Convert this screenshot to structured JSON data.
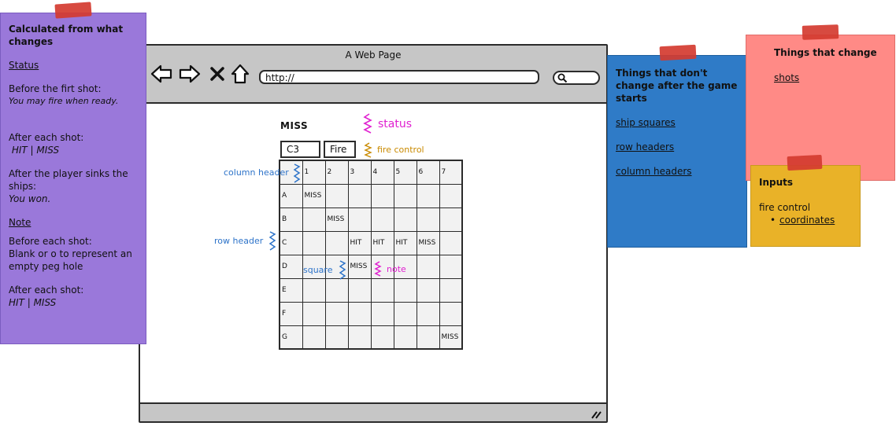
{
  "browser": {
    "title": "A Web Page",
    "address": "http://"
  },
  "content": {
    "status_text": "MISS",
    "annotations": {
      "status": "status",
      "fire_control": "fire control",
      "column_header": "column header",
      "row_header": "row header",
      "square": "square",
      "note": "note"
    },
    "coordinate_input": "C3",
    "fire_button": "Fire"
  },
  "board": {
    "column_headers": [
      "",
      "1",
      "2",
      "3",
      "4",
      "5",
      "6",
      "7"
    ],
    "rows": [
      {
        "header": "A",
        "cells": [
          "MISS",
          "",
          "",
          "",
          "",
          "",
          ""
        ]
      },
      {
        "header": "B",
        "cells": [
          "",
          "MISS",
          "",
          "",
          "",
          "",
          ""
        ]
      },
      {
        "header": "C",
        "cells": [
          "",
          "",
          "HIT",
          "HIT",
          "HIT",
          "MISS",
          ""
        ]
      },
      {
        "header": "D",
        "cells": [
          "",
          "",
          "MISS",
          "",
          "",
          "",
          ""
        ]
      },
      {
        "header": "E",
        "cells": [
          "",
          "",
          "",
          "",
          "",
          "",
          ""
        ]
      },
      {
        "header": "F",
        "cells": [
          "",
          "",
          "",
          "",
          "",
          "",
          ""
        ]
      },
      {
        "header": "G",
        "cells": [
          "",
          "",
          "",
          "",
          "",
          "",
          "MISS"
        ]
      }
    ]
  },
  "notes": {
    "purple": {
      "title": "Calculated from what changes",
      "status_link": "Status",
      "before_first": "Before the firt shot:",
      "before_first_value": "You may fire when ready.",
      "after_each": "After each shot:",
      "after_each_value": " HIT | MISS",
      "after_sink": "After the player sinks the ships:",
      "after_sink_value": "You won.",
      "note_link": "Note",
      "before_each": "Before each shot:",
      "before_each_value": "Blank or o to represent an empty peg hole",
      "after_each2": "After each shot:",
      "after_each2_value": "HIT | MISS"
    },
    "blue": {
      "title": "Things that don't change after the game starts",
      "items": [
        "ship squares",
        "row headers",
        "column headers"
      ]
    },
    "pink": {
      "title": "Things that change",
      "items": [
        "shots"
      ]
    },
    "yellow": {
      "title": "Inputs",
      "item": "fire control",
      "subitem": "coordinates"
    }
  },
  "colors": {
    "purple_note": "#9a78da",
    "blue_note": "#2f7bc7",
    "pink_note": "#ff8a86",
    "yellow_note": "#e9b228",
    "tape": "#d43b30",
    "annotation_magenta": "#e020d0",
    "annotation_orange": "#c98a00",
    "annotation_blue": "#2d73c9"
  }
}
